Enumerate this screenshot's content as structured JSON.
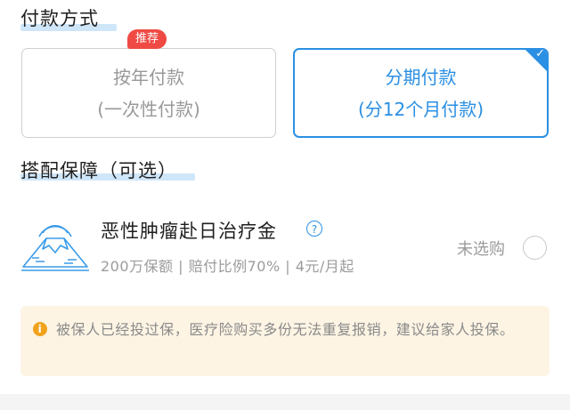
{
  "payment": {
    "title": "付款方式",
    "badge": "推荐",
    "options": [
      {
        "line1": "按年付款",
        "line2": "(一次性付款)",
        "selected": false
      },
      {
        "line1": "分期付款",
        "line2": "(分12个月付款)",
        "selected": true
      }
    ]
  },
  "addons": {
    "title": "搭配保障（可选）",
    "item": {
      "name": "恶性肿瘤赴日治疗金",
      "help": "?",
      "desc": "200万保额 | 赔付比例70% | 4元/月起",
      "status": "未选购",
      "icon": "mount-fuji-icon"
    }
  },
  "notice": {
    "icon": "info-icon",
    "icon_glyph": "i",
    "text": "被保人已经投过保，医疗险购买多份无法重复报销，建议给家人投保。"
  },
  "colors": {
    "accent": "#2b8fe3",
    "badge": "#ef4a43",
    "notice_bg": "#fdf4e4",
    "notice_icon": "#f0a21b"
  }
}
